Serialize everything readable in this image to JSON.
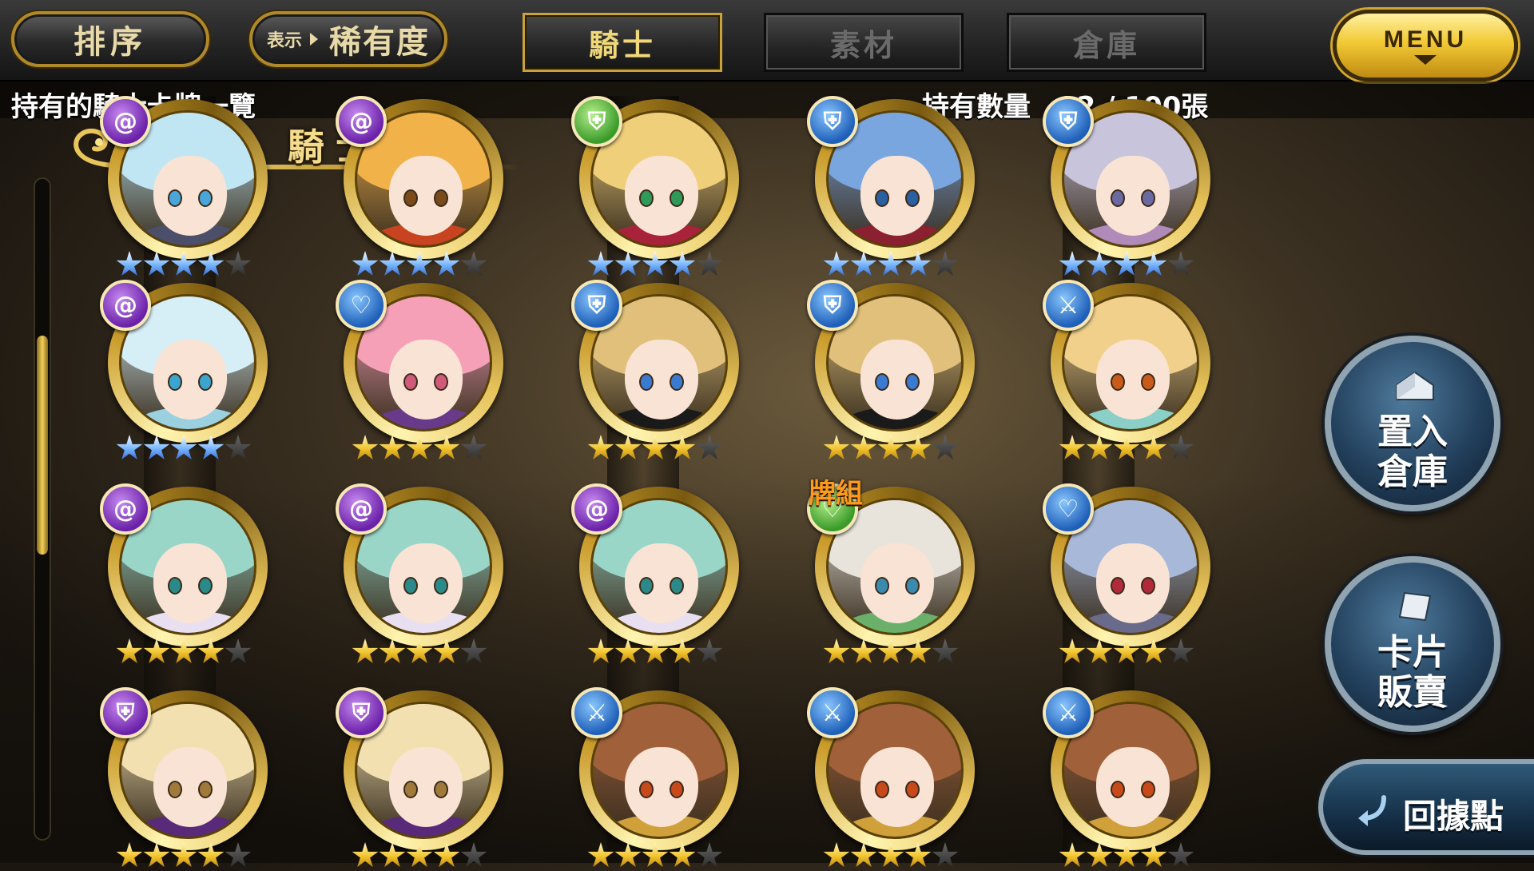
{
  "header": {
    "sort_label": "排序",
    "display_prefix": "表示",
    "display_value": "稀有度",
    "tabs": [
      {
        "label": "騎士",
        "active": true
      },
      {
        "label": "素材",
        "active": false
      },
      {
        "label": "倉庫",
        "active": false
      }
    ],
    "menu_label": "MENU"
  },
  "info": {
    "title": "持有的騎士卡牌一覽",
    "count_text": "持有數量　92 / 100張"
  },
  "section": {
    "label": "騎士"
  },
  "scroll": {
    "position": 0.2
  },
  "cards": [
    {
      "attr": "purple",
      "badge_icon": "swirl",
      "hair": "#bfe6f2",
      "eyes": "#4aa6d8",
      "outfit": "#4b4f6a",
      "stars": 4,
      "star_color": "blue",
      "deck": false
    },
    {
      "attr": "purple",
      "badge_icon": "swirl",
      "hair": "#f2b24a",
      "eyes": "#7a4a1a",
      "outfit": "#c8431f",
      "stars": 4,
      "star_color": "blue",
      "deck": false
    },
    {
      "attr": "green",
      "badge_icon": "shield",
      "hair": "#f0cf7a",
      "eyes": "#2f9a5a",
      "outfit": "#a8233a",
      "stars": 4,
      "star_color": "blue",
      "deck": false
    },
    {
      "attr": "blue",
      "badge_icon": "shield",
      "hair": "#7aa6e0",
      "eyes": "#2a5fa0",
      "outfit": "#8a2030",
      "stars": 4,
      "star_color": "blue",
      "deck": false
    },
    {
      "attr": "blue",
      "badge_icon": "shield",
      "hair": "#c8c4dc",
      "eyes": "#6a6aa0",
      "outfit": "#b08ab8",
      "stars": 4,
      "star_color": "blue",
      "deck": false
    },
    {
      "attr": "purple",
      "badge_icon": "swirl",
      "hair": "#d6eef6",
      "eyes": "#3aa6d0",
      "outfit": "#9ad0e0",
      "stars": 4,
      "star_color": "blue",
      "deck": false
    },
    {
      "attr": "blue",
      "badge_icon": "heart",
      "hair": "#f6a0b8",
      "eyes": "#d05a7a",
      "outfit": "#6a3a8a",
      "stars": 4,
      "star_color": "gold",
      "deck": false
    },
    {
      "attr": "blue",
      "badge_icon": "shield",
      "hair": "#e0c07a",
      "eyes": "#3a7ad0",
      "outfit": "#1a1a1a",
      "stars": 4,
      "star_color": "gold",
      "deck": false
    },
    {
      "attr": "blue",
      "badge_icon": "shield",
      "hair": "#e0c07a",
      "eyes": "#3a7ad0",
      "outfit": "#1a1a1a",
      "stars": 4,
      "star_color": "gold",
      "deck": false
    },
    {
      "attr": "blue",
      "badge_icon": "sword",
      "hair": "#f0d08a",
      "eyes": "#c85a1a",
      "outfit": "#8ad0c8",
      "stars": 4,
      "star_color": "gold",
      "deck": false
    },
    {
      "attr": "purple",
      "badge_icon": "swirl",
      "hair": "#9ad6c8",
      "eyes": "#2a8a8a",
      "outfit": "#e8e0f0",
      "stars": 4,
      "star_color": "gold",
      "deck": false
    },
    {
      "attr": "purple",
      "badge_icon": "swirl",
      "hair": "#9ad6c8",
      "eyes": "#2a8a8a",
      "outfit": "#e8e0f0",
      "stars": 4,
      "star_color": "gold",
      "deck": false
    },
    {
      "attr": "purple",
      "badge_icon": "swirl",
      "hair": "#9ad6c8",
      "eyes": "#2a8a8a",
      "outfit": "#e8e0f0",
      "stars": 4,
      "star_color": "gold",
      "deck": false
    },
    {
      "attr": "green",
      "badge_icon": "heart",
      "hair": "#e8e4dc",
      "eyes": "#3a8ab0",
      "outfit": "#6ab06a",
      "stars": 4,
      "star_color": "gold",
      "deck": true
    },
    {
      "attr": "blue",
      "badge_icon": "heart",
      "hair": "#a8b8d8",
      "eyes": "#b02a3a",
      "outfit": "#6a6a8a",
      "stars": 4,
      "star_color": "gold",
      "deck": false
    },
    {
      "attr": "purple",
      "badge_icon": "shield",
      "hair": "#f2e0b0",
      "eyes": "#a07a3a",
      "outfit": "#5a2a7a",
      "stars": 4,
      "star_color": "gold",
      "deck": false
    },
    {
      "attr": "purple",
      "badge_icon": "shield",
      "hair": "#f2e0b0",
      "eyes": "#a07a3a",
      "outfit": "#5a2a7a",
      "stars": 4,
      "star_color": "gold",
      "deck": false
    },
    {
      "attr": "blue",
      "badge_icon": "sword",
      "hair": "#a0603a",
      "eyes": "#c84a1a",
      "outfit": "#d0a03a",
      "stars": 4,
      "star_color": "gold",
      "deck": false
    },
    {
      "attr": "blue",
      "badge_icon": "sword",
      "hair": "#a0603a",
      "eyes": "#c84a1a",
      "outfit": "#d0a03a",
      "stars": 4,
      "star_color": "gold",
      "deck": false
    },
    {
      "attr": "blue",
      "badge_icon": "sword",
      "hair": "#a0603a",
      "eyes": "#c84a1a",
      "outfit": "#d0a03a",
      "stars": 4,
      "star_color": "gold",
      "deck": false
    }
  ],
  "deck_label": "牌組",
  "side_buttons": {
    "storage_line1": "置入",
    "storage_line2": "倉庫",
    "sell_line1": "卡片",
    "sell_line2": "販賣",
    "back_label": "回據點"
  }
}
